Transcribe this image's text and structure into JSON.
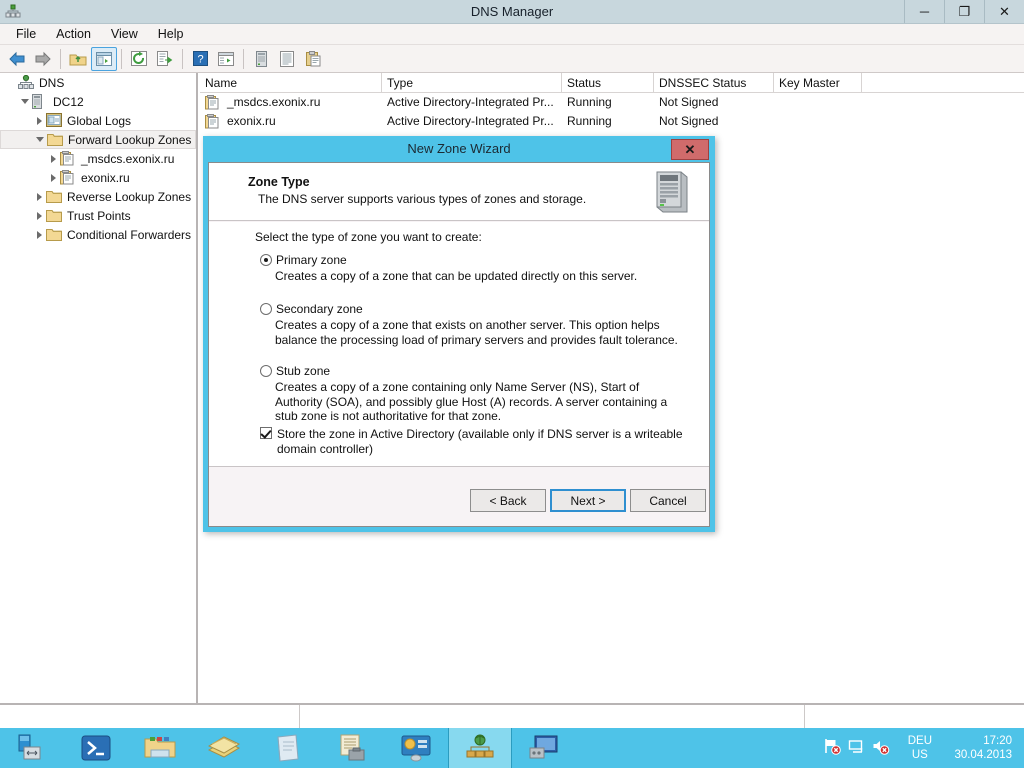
{
  "window": {
    "title": "DNS Manager",
    "icon": "dns-server-icon",
    "controls": {
      "minimize": "─",
      "restore": "❐",
      "close": "✕"
    }
  },
  "menubar": {
    "items": [
      "File",
      "Action",
      "View",
      "Help"
    ]
  },
  "toolbar": {
    "items": [
      {
        "name": "back-button",
        "icon": "left-arrow-icon"
      },
      {
        "name": "forward-button",
        "icon": "right-arrow-icon"
      },
      {
        "name": "up-folder-button",
        "icon": "up-folder-icon"
      },
      {
        "name": "show-hide-console-tree-button",
        "icon": "console-tree-icon",
        "active": true
      },
      {
        "name": "refresh-button",
        "icon": "refresh-icon"
      },
      {
        "name": "export-list-button",
        "icon": "export-list-icon"
      },
      {
        "name": "help-button",
        "icon": "question-mark-icon"
      },
      {
        "name": "properties-button",
        "icon": "properties-window-icon"
      },
      {
        "name": "new-server-button",
        "icon": "server-tower-icon"
      },
      {
        "name": "new-zone-button",
        "icon": "document-lines-icon"
      },
      {
        "name": "paste-button",
        "icon": "clipboard-icon"
      }
    ]
  },
  "tree": {
    "items": [
      {
        "label": "DNS",
        "indent": 0,
        "twisty": "none",
        "icon": "dns-root-icon",
        "selected": false
      },
      {
        "label": "DC12",
        "indent": 1,
        "twisty": "expanded",
        "icon": "server-icon",
        "selected": false
      },
      {
        "label": "Global Logs",
        "indent": 2,
        "twisty": "collapsed",
        "icon": "global-logs-icon",
        "selected": false
      },
      {
        "label": "Forward Lookup Zones",
        "indent": 2,
        "twisty": "expanded",
        "icon": "folder-icon",
        "selected": true
      },
      {
        "label": "_msdcs.exonix.ru",
        "indent": 3,
        "twisty": "collapsed",
        "icon": "zone-icon",
        "selected": false
      },
      {
        "label": "exonix.ru",
        "indent": 3,
        "twisty": "collapsed",
        "icon": "zone-icon",
        "selected": false
      },
      {
        "label": "Reverse Lookup Zones",
        "indent": 2,
        "twisty": "collapsed",
        "icon": "folder-icon",
        "selected": false
      },
      {
        "label": "Trust Points",
        "indent": 2,
        "twisty": "collapsed",
        "icon": "folder-icon",
        "selected": false
      },
      {
        "label": "Conditional Forwarders",
        "indent": 2,
        "twisty": "collapsed",
        "icon": "folder-icon",
        "selected": false
      }
    ]
  },
  "list": {
    "columns": [
      {
        "label": "Name",
        "width": 182
      },
      {
        "label": "Type",
        "width": 180
      },
      {
        "label": "Status",
        "width": 92
      },
      {
        "label": "DNSSEC Status",
        "width": 120
      },
      {
        "label": "Key Master",
        "width": 88
      }
    ],
    "rows": [
      {
        "icon": "zone-icon",
        "name": "_msdcs.exonix.ru",
        "type": "Active Directory-Integrated Pr...",
        "status": "Running",
        "dnssec_status": "Not Signed",
        "key_master": ""
      },
      {
        "icon": "zone-icon",
        "name": "exonix.ru",
        "type": "Active Directory-Integrated Pr...",
        "status": "Running",
        "dnssec_status": "Not Signed",
        "key_master": ""
      }
    ]
  },
  "statusbar": {
    "panes": [
      "",
      "",
      ""
    ]
  },
  "dialog": {
    "title": "New Zone Wizard",
    "close_label": "✕",
    "header": {
      "title": "Zone Type",
      "subtitle": "The DNS server supports various types of zones and storage.",
      "icon": "server-tower-icon"
    },
    "prompt": "Select the type of zone you want to create:",
    "options": [
      {
        "label": "Primary zone",
        "selected": true,
        "description": "Creates a copy of a zone that can be updated directly on this server."
      },
      {
        "label": "Secondary zone",
        "selected": false,
        "description": "Creates a copy of a zone that exists on another server. This option helps balance the processing load of primary servers and provides fault tolerance."
      },
      {
        "label": "Stub zone",
        "selected": false,
        "description": "Creates a copy of a zone containing only Name Server (NS), Start of Authority (SOA), and possibly glue Host (A) records. A server containing a stub zone is not authoritative for that zone."
      }
    ],
    "checkbox": {
      "checked": true,
      "label": "Store the zone in Active Directory (available only if DNS server is a writeable domain controller)"
    },
    "buttons": {
      "back": "< Back",
      "next": "Next >",
      "cancel": "Cancel",
      "focused": "next"
    }
  },
  "taskbar": {
    "apps": [
      {
        "name": "taskbar-server-manager",
        "icon": "server-manager-icon",
        "active": false
      },
      {
        "name": "taskbar-powershell",
        "icon": "powershell-icon",
        "active": false
      },
      {
        "name": "taskbar-file-explorer",
        "icon": "folder-icon",
        "active": false
      },
      {
        "name": "taskbar-books",
        "icon": "books-icon",
        "active": false
      },
      {
        "name": "taskbar-notepad",
        "icon": "notepad-icon",
        "active": false
      },
      {
        "name": "taskbar-scripts",
        "icon": "script-toolbox-icon",
        "active": false
      },
      {
        "name": "taskbar-control-panel",
        "icon": "control-panel-icon",
        "active": false
      },
      {
        "name": "taskbar-dns-manager",
        "icon": "dns-manager-icon",
        "active": true
      },
      {
        "name": "taskbar-remote-desktop",
        "icon": "remote-desktop-icon",
        "active": false
      }
    ],
    "tray": {
      "icons": [
        "network-flag-error-icon",
        "network-icon",
        "volume-muted-icon"
      ],
      "language_line1": "DEU",
      "language_line2": "US",
      "time": "17:20",
      "date": "30.04.2013"
    }
  },
  "colors": {
    "accent": "#4ec3e8",
    "titlebar": "#c8d7dd",
    "toolbar": "#f6f3f2",
    "dialog_close": "#d06b6b",
    "focus_border": "#2f8fd0"
  }
}
